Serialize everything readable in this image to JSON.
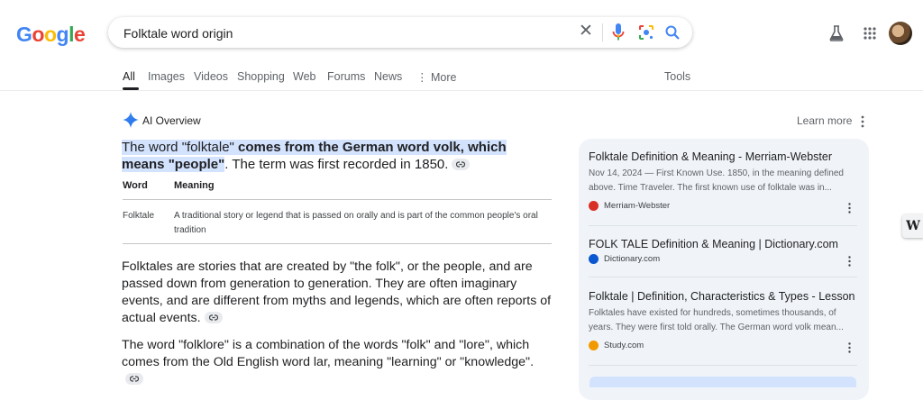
{
  "logo": {
    "letters": [
      "G",
      "o",
      "o",
      "g",
      "l",
      "e"
    ],
    "colors": [
      "#4285f4",
      "#ea4335",
      "#fbbc05",
      "#4285f4",
      "#34a853",
      "#ea4335"
    ]
  },
  "search": {
    "query": "Folktale word origin"
  },
  "icons": {
    "clear": "close-icon",
    "mic": "mic-icon",
    "lens": "lens-icon",
    "search": "search-icon",
    "labs": "flask-icon",
    "apps": "apps-icon"
  },
  "clear_glyph": "✕",
  "tabs": [
    {
      "label": "All"
    },
    {
      "label": "Images"
    },
    {
      "label": "Videos"
    },
    {
      "label": "Shopping"
    },
    {
      "label": "Web"
    },
    {
      "label": "Forums"
    },
    {
      "label": "News"
    },
    {
      "label": "⋮ More"
    }
  ],
  "tools": "Tools",
  "ai": {
    "title": "AI Overview",
    "learn_more": "Learn more",
    "lead_a": "The word \"folktale\" ",
    "lead_b": "comes from the German word volk, which means \"people\"",
    "lead_c": ". The term was first recorded in 1850.",
    "table": {
      "headers": [
        "Word",
        "Meaning"
      ],
      "rows": [
        {
          "word": "Folktale",
          "meaning": "A traditional story or legend that is passed on orally and is part of the common people's oral tradition"
        }
      ]
    },
    "para1": "Folktales are stories that are created by \"the folk\", or the people, and are passed down from generation to generation. They are often imaginary events, and are different from myths and legends, which are often reports of actual events.",
    "para2": "The word \"folklore\" is a combination of the words \"folk\" and \"lore\", which comes from the Old English word lar, meaning \"learning\" or \"knowledge\"."
  },
  "sources": [
    {
      "title": "Folktale Definition & Meaning - Merriam-Webster",
      "desc": "Nov 14, 2024 — First Known Use. 1850, in the meaning defined above. Time Traveler. The first known use of folktale was in...",
      "site": "Merriam-Webster",
      "icon_color": "#d93025"
    },
    {
      "title": "FOLK TALE Definition & Meaning | Dictionary.com",
      "desc": "",
      "site": "Dictionary.com",
      "icon_color": "#0b57d0"
    },
    {
      "title": "Folktale | Definition, Characteristics & Types - Lesson",
      "desc": "Folktales have existed for hundreds, sometimes thousands, of years. They were first told orally. The German word volk mean...",
      "site": "Study.com",
      "icon_color": "#f29900"
    }
  ],
  "side_badge": "W"
}
